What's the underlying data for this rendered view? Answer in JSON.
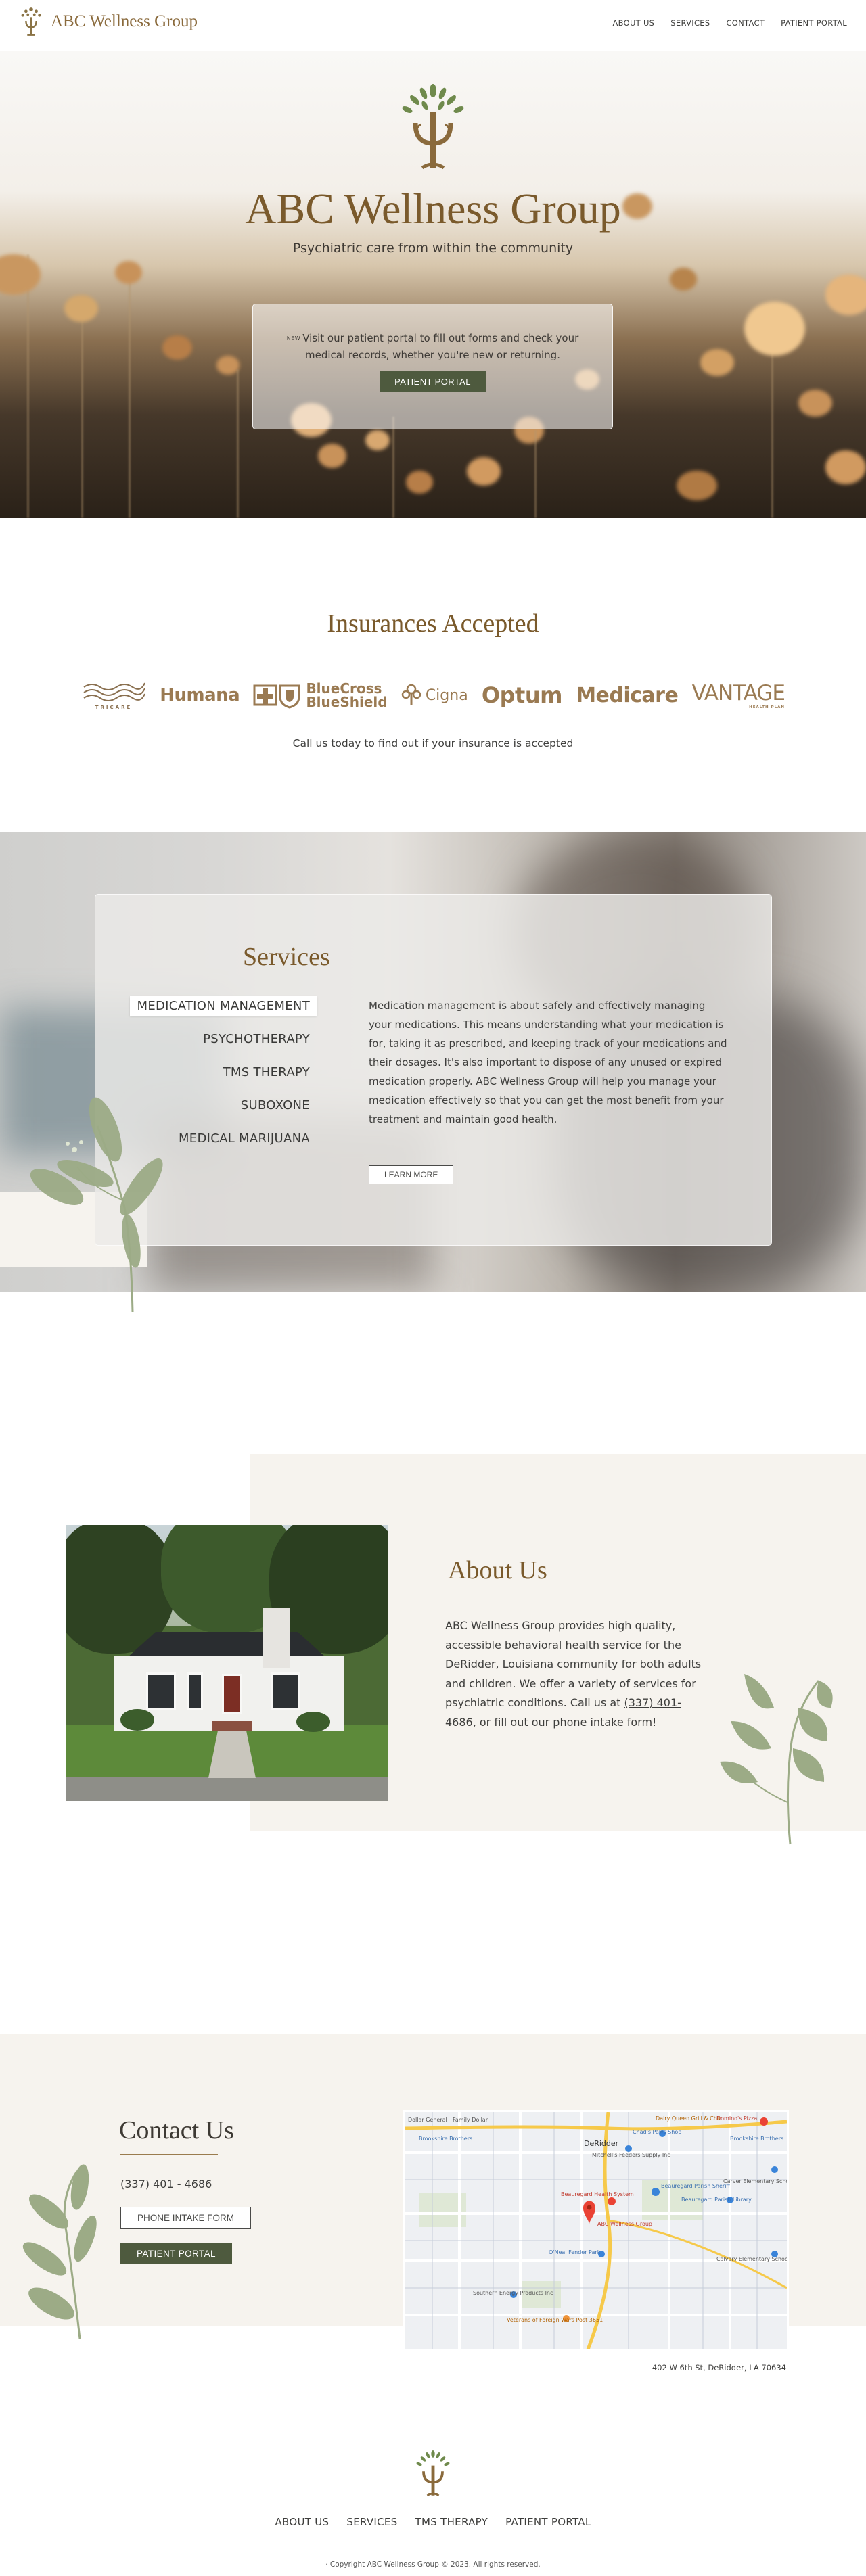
{
  "nav": {
    "brand": "ABC Wellness Group",
    "links": [
      "ABOUT US",
      "SERVICES",
      "CONTACT",
      "PATIENT PORTAL"
    ]
  },
  "hero": {
    "title": "ABC Wellness Group",
    "tagline": "Psychiatric care from within the community",
    "card": {
      "badge": "NEW",
      "text": "Visit our patient portal to fill out forms and check your medical records, whether you're new or returning.",
      "button": "PATIENT PORTAL"
    }
  },
  "insurance": {
    "title": "Insurances Accepted",
    "logos": [
      "TRICARE",
      "Humana",
      "BlueCross",
      "BlueShield",
      "Cigna",
      "Optum",
      "Medicare",
      "VANTAGE",
      "HEALTH PLAN"
    ],
    "call": "Call us today to find out if your insurance is accepted"
  },
  "services": {
    "title": "Services",
    "tabs": [
      "MEDICATION MANAGEMENT",
      "PSYCHOTHERAPY",
      "TMS THERAPY",
      "SUBOXONE",
      "MEDICAL MARIJUANA"
    ],
    "active_tab": "MEDICATION MANAGEMENT",
    "description": "Medication management is about safely and effectively managing your medications. This means understanding what your medication is for, taking it as prescribed, and keeping track of your medications and their dosages. It's also important to dispose of any unused or expired medication properly. ABC Wellness Group will help you manage your medication effectively so that you can get the most benefit from your treatment and maintain good health.",
    "button": "LEARN MORE"
  },
  "about": {
    "title": "About Us",
    "text_before": "ABC Wellness Group provides high quality, accessible behavioral health service for the DeRidder, Louisiana community for both adults and children. We offer a variety of services for psychiatric conditions. Call us at",
    "phone_link": "(337) 401-4686",
    "text_middle": ", or fill out our",
    "form_link": "phone intake form",
    "text_end": "!"
  },
  "contact": {
    "title": "Contact Us",
    "phone": "(337) 401 - 4686",
    "intake_button": "PHONE INTAKE FORM",
    "portal_button": "PATIENT PORTAL",
    "address": "402 W 6th St, DeRidder, LA 70634",
    "map": {
      "labels": [
        "Dollar General",
        "Family Dollar",
        "Dairy Queen Grill & Chill",
        "Domino's Pizza",
        "Chad's Paws Shop",
        "Brookshire Brothers",
        "Brookshire Brothers",
        "DeRidder",
        "Mitchell's Feeders Supply Inc",
        "Beauregard Health System",
        "Beauregard Parish Sheriff",
        "ABC Wellness Group",
        "Carver Elementary School",
        "Beauregard Parish Library",
        "O'Neal Fender Park",
        "Southern Energy Products Inc",
        "Veterans of Foreign Wars Post 3651",
        "Calvary Elementary School"
      ],
      "colors": {
        "highway": "#f6c94a",
        "pin": "#ea4335",
        "poi": "#3a84d9"
      }
    }
  },
  "footer": {
    "links": [
      "ABOUT US",
      "SERVICES",
      "TMS THERAPY",
      "PATIENT PORTAL"
    ],
    "copyright": "· Copyright ABC Wellness Group © 2023. All rights reserved."
  },
  "colors": {
    "accent": "#7a5a2c",
    "button": "#4e5a3e",
    "cream": "#f6f3ee",
    "leaf": "#9cab86"
  }
}
